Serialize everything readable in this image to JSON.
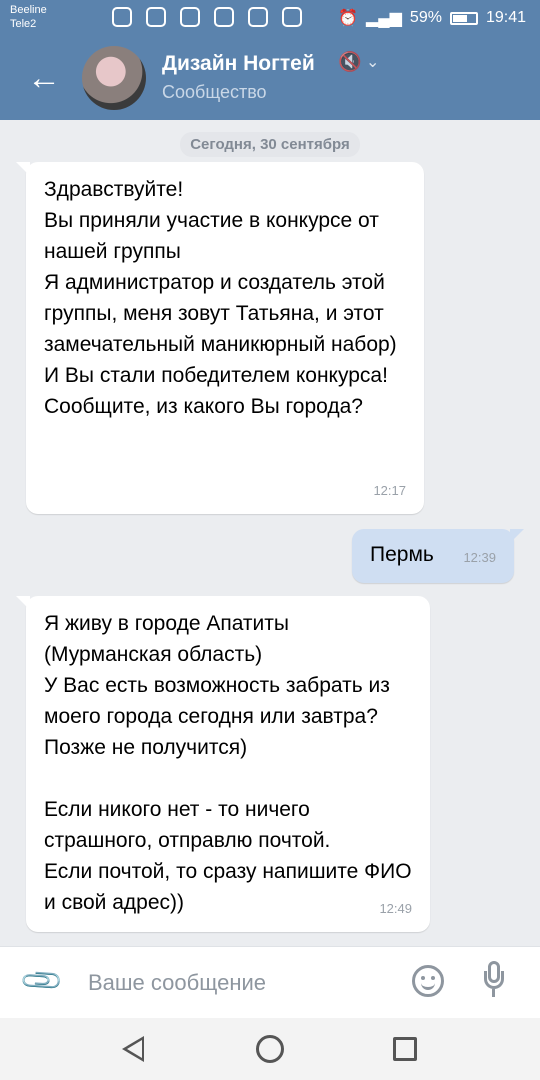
{
  "status_bar": {
    "carrier1": "Beeline",
    "carrier2": "Tele2",
    "battery": "59%",
    "time": "19:41",
    "icons": [
      "star-icon",
      "missed-call-icon",
      "instagram-icon",
      "music-icon",
      "user-app-icon",
      "instagram-icon",
      "image-icon",
      "alarm-icon",
      "signal-icon",
      "battery-icon"
    ]
  },
  "header": {
    "title": "Дизайн Ногтей",
    "subtitle": "Сообщество"
  },
  "date_separator": "Сегодня, 30 сентября",
  "messages": [
    {
      "direction": "incoming",
      "text": "Здравствуйте!\nВы приняли участие в конкурсе от нашей группы\nЯ администратор и создатель этой группы, меня зовут Татьяна, и этот замечательный маникюрный набор)\nИ Вы стали победителем конкурса!\nСообщите, из какого Вы города?",
      "time": "12:17"
    },
    {
      "direction": "outgoing",
      "text": "Пермь",
      "time": "12:39"
    },
    {
      "direction": "incoming",
      "text": "Я живу в городе Апатиты (Мурманская область)\nУ Вас есть возможность забрать из моего города сегодня или завтра? Позже не получится)\n\nЕсли никого нет - то ничего страшного, отправлю почтой.\nЕсли почтой, то сразу напишите ФИО и свой адрес))",
      "time": "12:49"
    }
  ],
  "composer": {
    "placeholder": "Ваше сообщение"
  },
  "colors": {
    "header": "#5b83ad",
    "incoming_bubble": "#ffffff",
    "outgoing_bubble": "#cfdef2",
    "background": "#ebedf0"
  }
}
